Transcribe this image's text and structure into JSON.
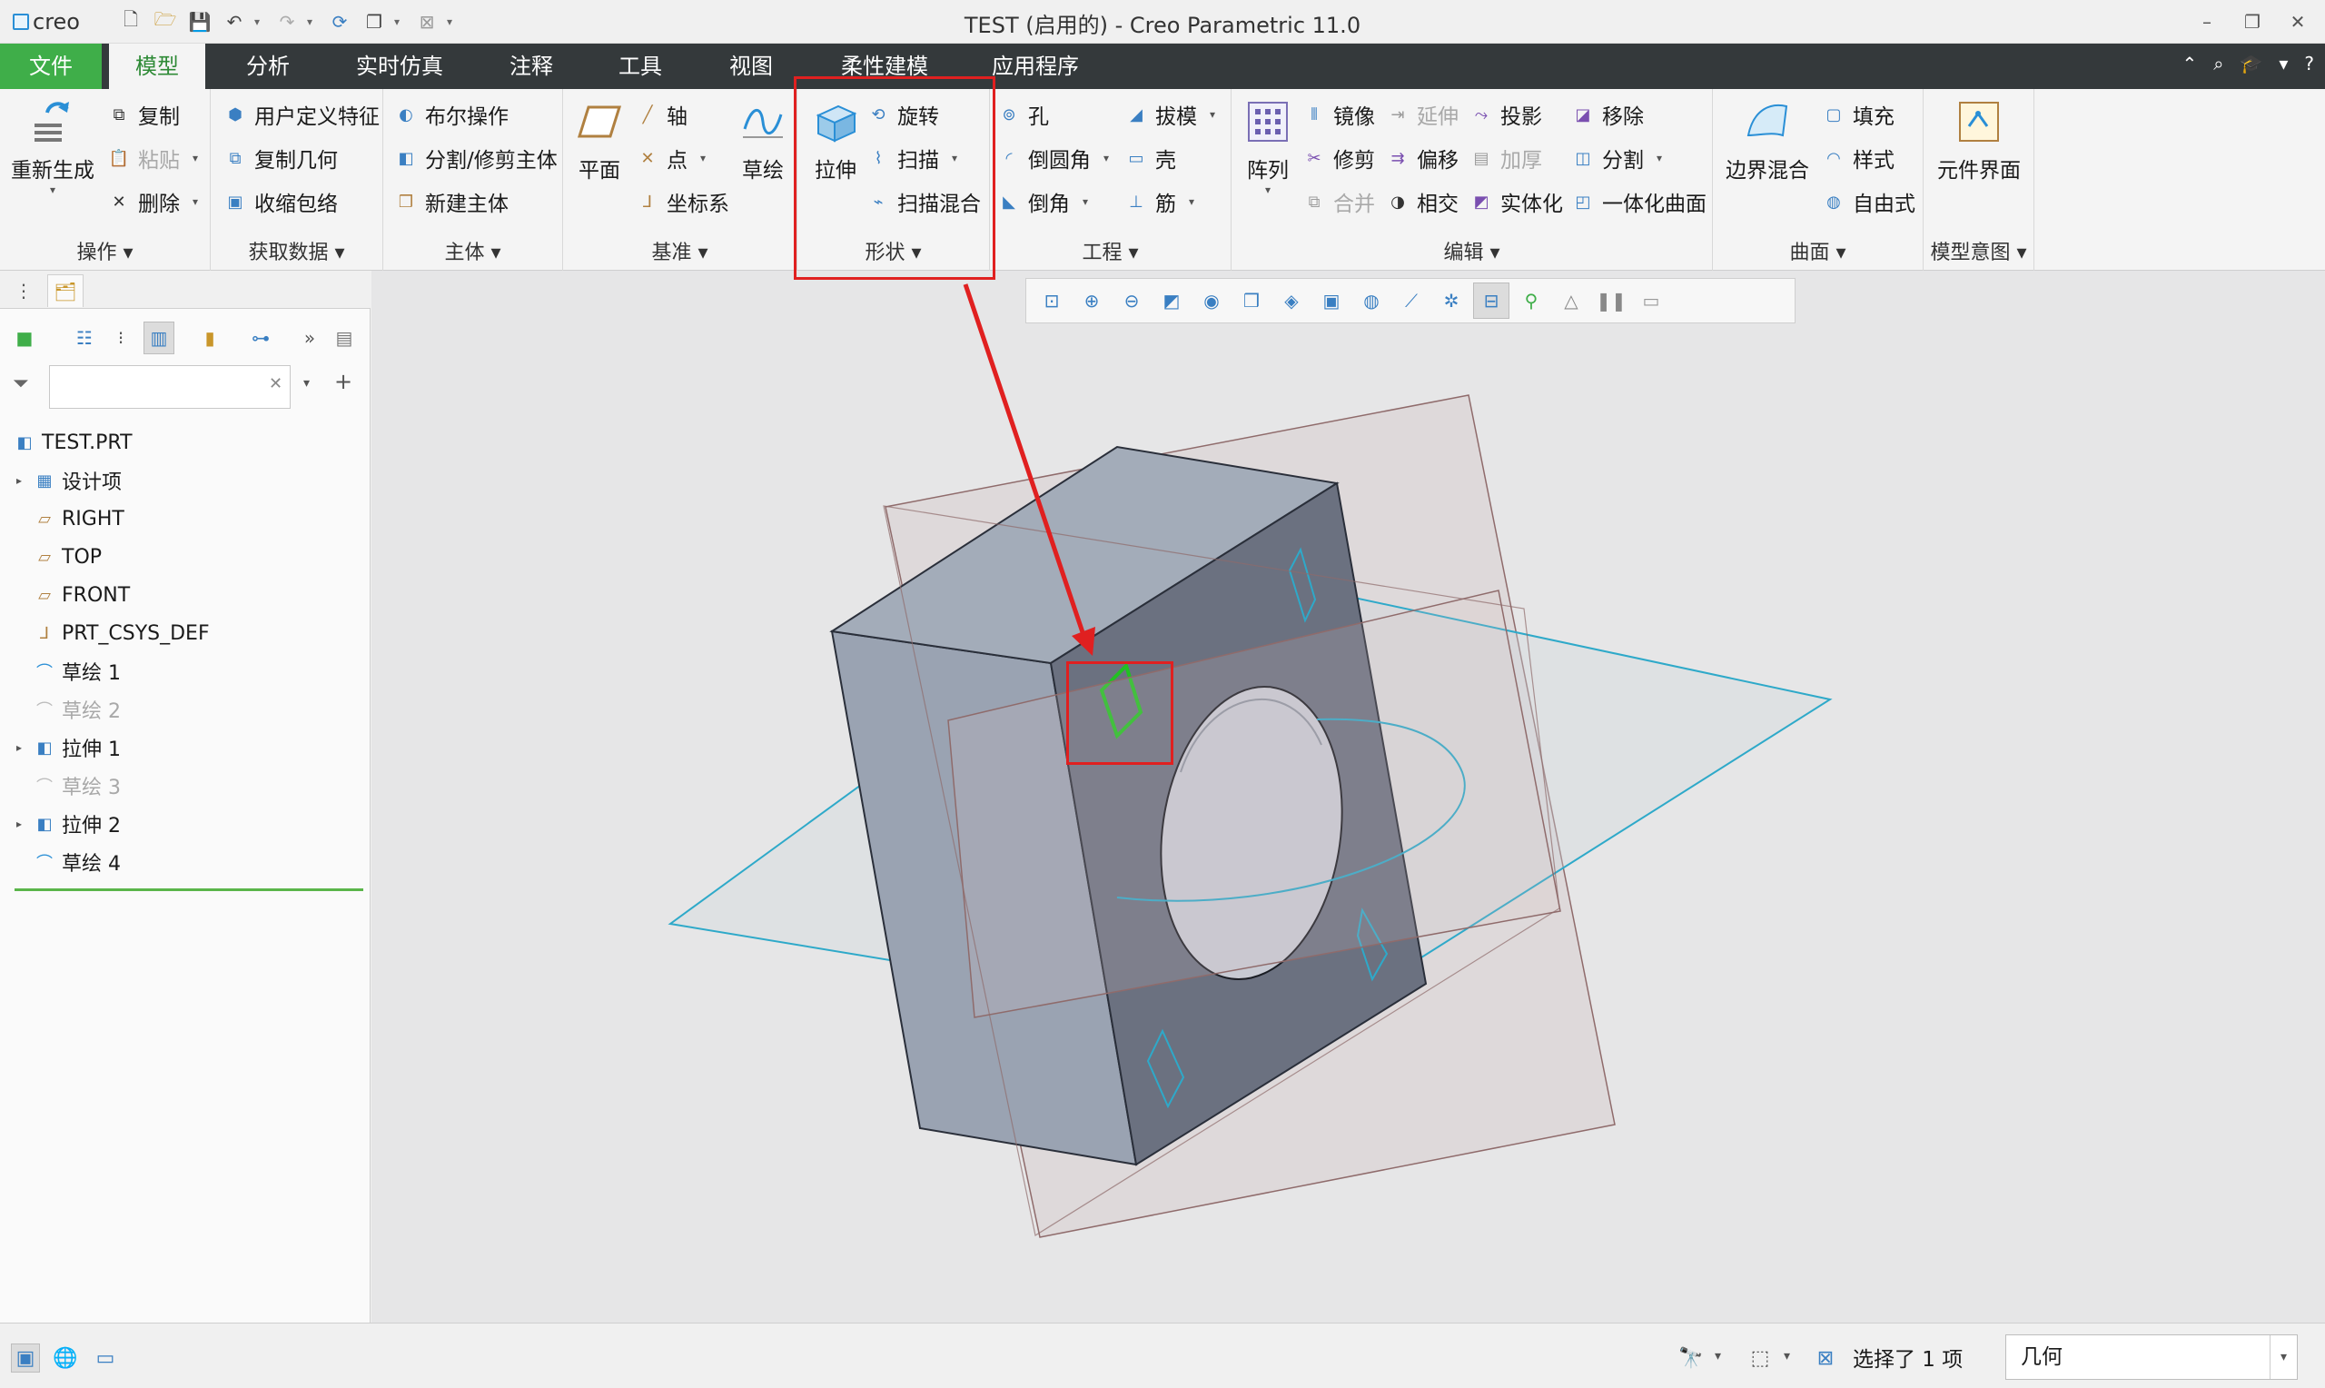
{
  "app": {
    "logo": "creo",
    "window_title": "TEST (启用的) - Creo Parametric 11.0"
  },
  "tabs": [
    {
      "label": "文件"
    },
    {
      "label": "模型"
    },
    {
      "label": "分析"
    },
    {
      "label": "实时仿真"
    },
    {
      "label": "注释"
    },
    {
      "label": "工具"
    },
    {
      "label": "视图"
    },
    {
      "label": "柔性建模"
    },
    {
      "label": "应用程序"
    }
  ],
  "ribbon": {
    "operations": {
      "label": "操作",
      "regenerate": "重新生成",
      "copy": "复制",
      "paste": "粘贴",
      "delete": "删除"
    },
    "get_data": {
      "label": "获取数据",
      "udf": "用户定义特征",
      "copy_geom": "复制几何",
      "shrinkwrap": "收缩包络"
    },
    "body": {
      "label": "主体",
      "boolean": "布尔操作",
      "split_trim": "分割/修剪主体",
      "new_body": "新建主体"
    },
    "datum": {
      "label": "基准",
      "plane": "平面",
      "axis": "轴",
      "point": "点",
      "csys": "坐标系",
      "sketch": "草绘"
    },
    "shapes": {
      "label": "形状",
      "extrude": "拉伸",
      "revolve": "旋转",
      "sweep": "扫描",
      "swept_blend": "扫描混合"
    },
    "engineering": {
      "label": "工程",
      "hole": "孔",
      "round": "倒圆角",
      "chamfer": "倒角",
      "draft": "拔模",
      "shell": "壳",
      "rib": "筋"
    },
    "editing": {
      "label": "编辑",
      "pattern": "阵列",
      "mirror": "镜像",
      "trim": "修剪",
      "merge": "合并",
      "extend": "延伸",
      "offset": "偏移",
      "intersect": "相交",
      "project": "投影",
      "thicken": "加厚",
      "solidify": "实体化",
      "remove": "移除",
      "split": "分割",
      "unify": "一体化曲面"
    },
    "surfaces": {
      "label": "曲面",
      "boundary_blend": "边界混合",
      "fill": "填充",
      "style": "样式",
      "freestyle": "自由式"
    },
    "model_intent": {
      "label": "模型意图",
      "component_interface": "元件界面"
    }
  },
  "model_tree": {
    "root": "TEST.PRT",
    "items": [
      {
        "label": "设计项"
      },
      {
        "label": "RIGHT"
      },
      {
        "label": "TOP"
      },
      {
        "label": "FRONT"
      },
      {
        "label": "PRT_CSYS_DEF"
      },
      {
        "label": "草绘 1"
      },
      {
        "label": "草绘 2"
      },
      {
        "label": "拉伸 1"
      },
      {
        "label": "草绘 3"
      },
      {
        "label": "拉伸 2"
      },
      {
        "label": "草绘 4"
      }
    ]
  },
  "status": {
    "selection": "选择了 1 项",
    "filter_value": "几何"
  },
  "colors": {
    "file_tab": "#3fae49",
    "tabbar": "#34393b",
    "annotation": "#e02020",
    "highlight": "#22c022"
  }
}
